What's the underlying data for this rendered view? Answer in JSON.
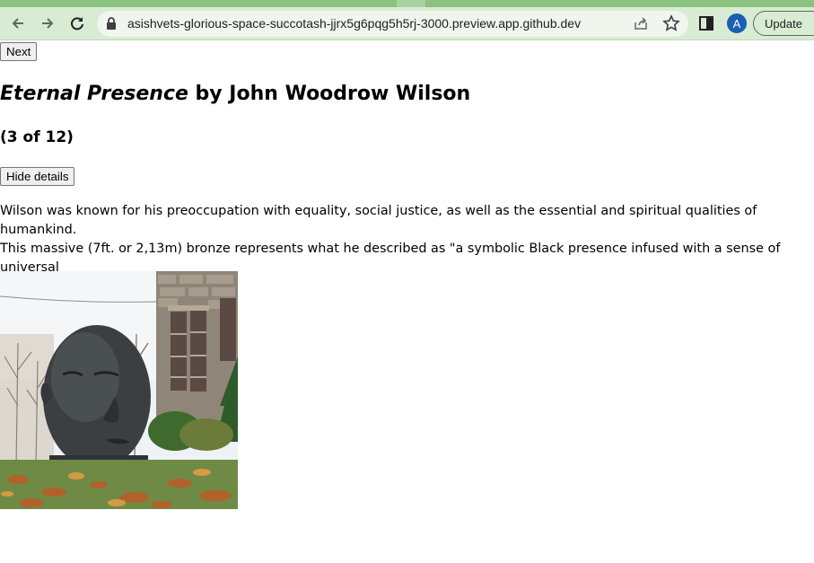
{
  "browser": {
    "url": "asishvets-glorious-space-succotash-jjrx5g6pqg5h5rj-3000.preview.app.github.dev",
    "avatar_letter": "A",
    "update_label": "Update"
  },
  "page": {
    "next_label": "Next",
    "artwork_title": "Eternal Presence",
    "by_text": " by John Woodrow Wilson",
    "counter": "(3 of 12)",
    "details_label": "Hide details",
    "description": "Wilson was known for his preoccupation with equality, social justice, as well as the essential and spiritual qualities of humankind.\nThis massive (7ft. or 2,13m) bronze represents what he described as \"a symbolic Black presence infused with a sense of universal\nhumanity.\""
  },
  "colors": {
    "toolbar_bg": "#d8ecd3",
    "tab_active": "#8cc27f",
    "avatar_bg": "#1a5fb4"
  },
  "icons": [
    "back-arrow-icon",
    "forward-arrow-icon",
    "reload-icon",
    "lock-icon",
    "share-icon",
    "star-icon",
    "side-panel-icon"
  ]
}
